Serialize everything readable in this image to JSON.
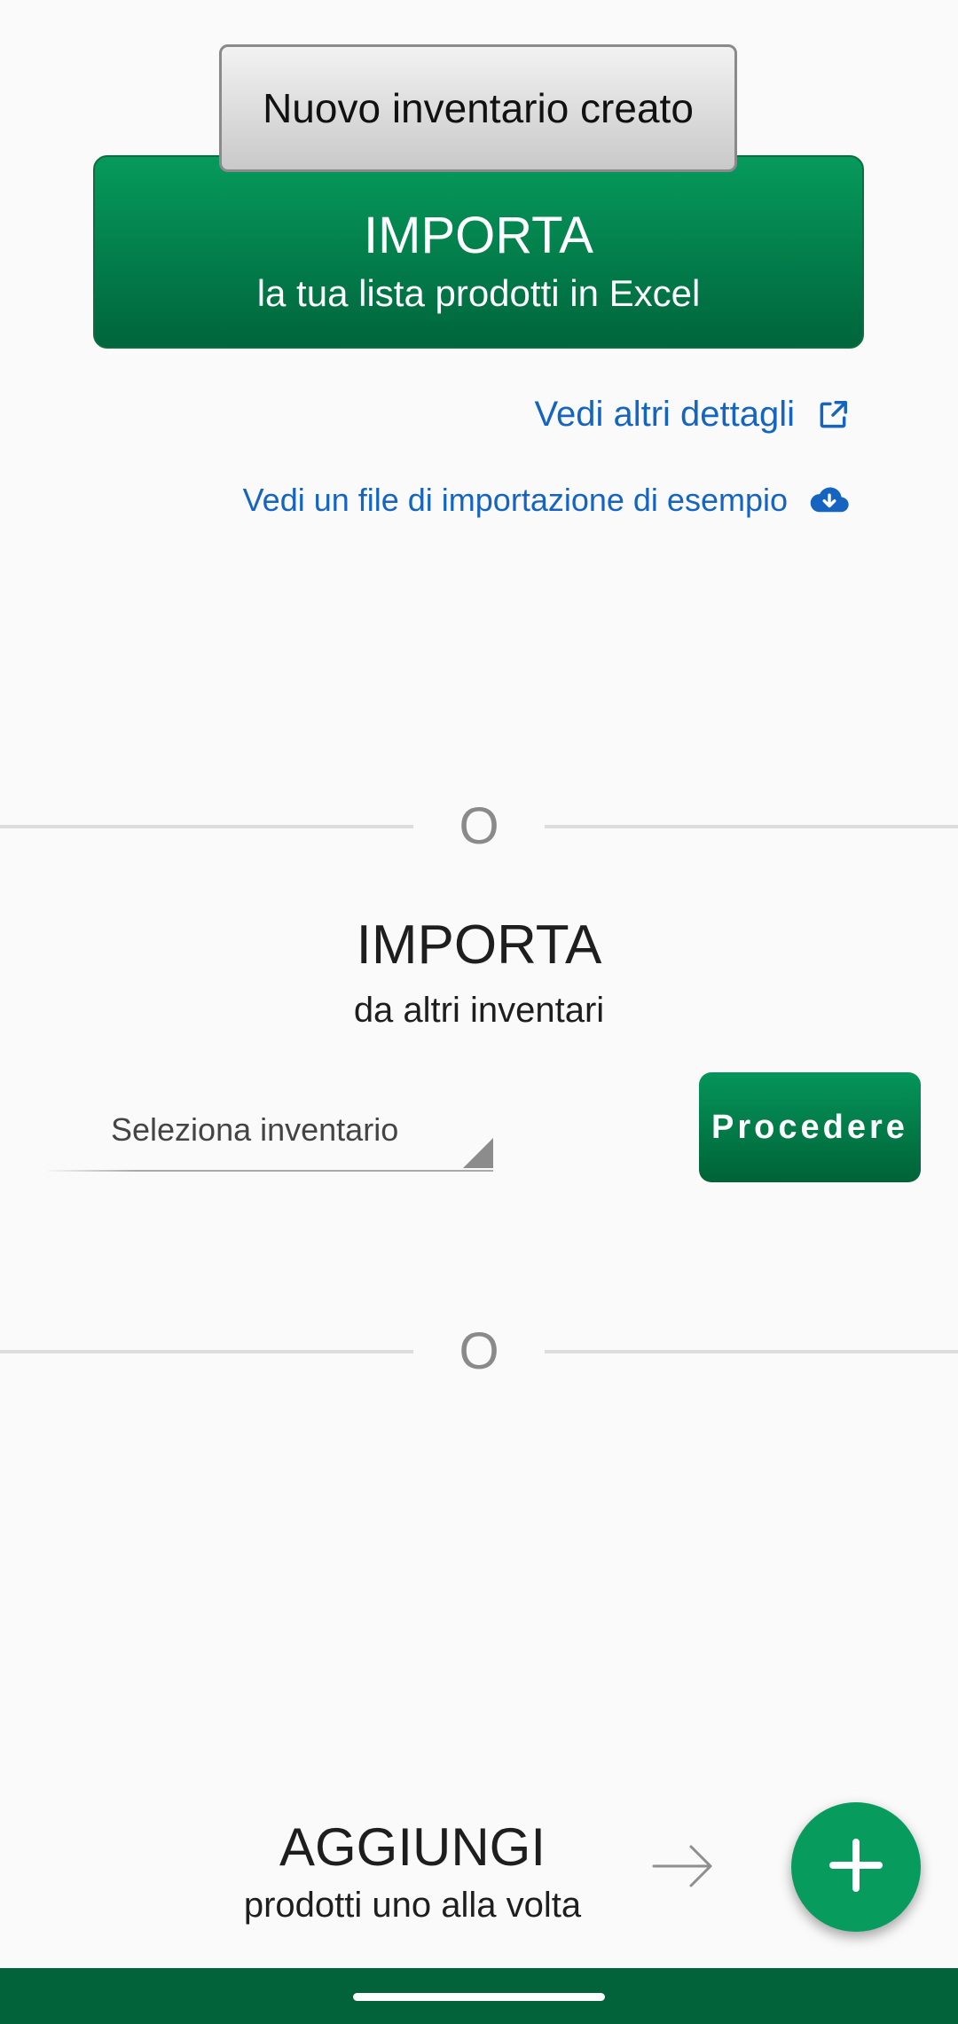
{
  "toast": {
    "text": "Nuovo inventario creato"
  },
  "import_excel": {
    "title": "IMPORTA",
    "subtitle": "la tua lista prodotti in Excel"
  },
  "links": {
    "details": {
      "label": "Vedi altri dettagli",
      "icon": "external-link-icon"
    },
    "sample": {
      "label": "Vedi un file di importazione di esempio",
      "icon": "cloud-download-icon"
    }
  },
  "dividers": {
    "or_label": "O"
  },
  "import_inventories": {
    "title": "IMPORTA",
    "subtitle": "da altri inventari",
    "select_placeholder": "Seleziona inventario",
    "proceed_label": "Procedere"
  },
  "add_products": {
    "title": "AGGIUNGI",
    "subtitle": "prodotti uno alla volta",
    "arrow_icon": "arrow-right-icon",
    "fab_icon": "plus-icon"
  },
  "colors": {
    "accent_green": "#079b5e",
    "dark_green": "#02623a",
    "link_blue": "#1565c0"
  }
}
